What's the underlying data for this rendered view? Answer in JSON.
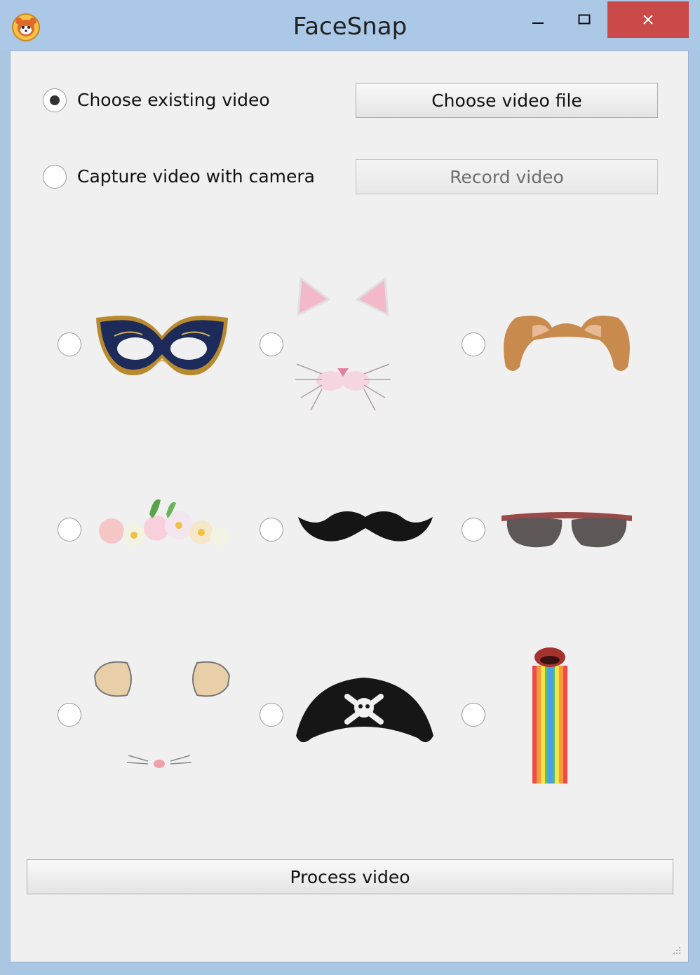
{
  "window": {
    "title": "FaceSnap",
    "app_icon": "red-panda-icon",
    "controls": [
      "minimize-icon",
      "maximize-icon",
      "close-icon"
    ],
    "close_color": "#c94a48"
  },
  "source": {
    "existing_label": "Choose existing video",
    "existing_selected": true,
    "camera_label": "Capture video with camera",
    "camera_selected": false,
    "choose_file_button": "Choose video file",
    "record_button": "Record video",
    "record_enabled": false
  },
  "filters": [
    {
      "icon": "masquerade-mask-icon",
      "selected": false
    },
    {
      "icon": "cat-ears-nose-icon",
      "selected": false
    },
    {
      "icon": "dog-ears-icon",
      "selected": false
    },
    {
      "icon": "flower-crown-icon",
      "selected": false
    },
    {
      "icon": "mustache-icon",
      "selected": false
    },
    {
      "icon": "sunglasses-icon",
      "selected": false
    },
    {
      "icon": "mouse-ears-nose-icon",
      "selected": false
    },
    {
      "icon": "pirate-hat-icon",
      "selected": false
    },
    {
      "icon": "rainbow-tongue-icon",
      "selected": false
    }
  ],
  "process_button": "Process video"
}
